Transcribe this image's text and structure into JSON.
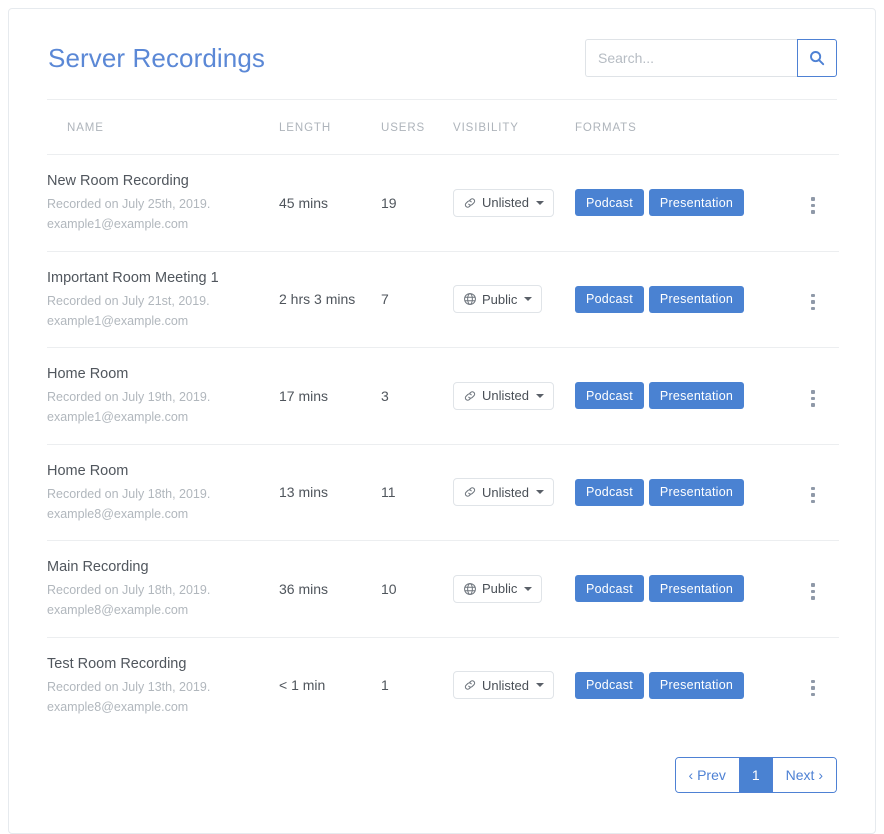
{
  "header": {
    "title": "Server Recordings",
    "search": {
      "placeholder": "Search...",
      "value": "",
      "button_icon": "search-icon"
    }
  },
  "table": {
    "columns": [
      {
        "key": "name",
        "label": "NAME"
      },
      {
        "key": "length",
        "label": "LENGTH"
      },
      {
        "key": "users",
        "label": "USERS"
      },
      {
        "key": "visibility",
        "label": "VISIBILITY"
      },
      {
        "key": "formats",
        "label": "FORMATS"
      },
      {
        "key": "actions",
        "label": ""
      }
    ],
    "rows": [
      {
        "name": "New Room Recording",
        "recorded_on": "Recorded on July 25th, 2019.",
        "email": "example1@example.com",
        "length": "45 mins",
        "users": "19",
        "visibility": "Unlisted",
        "visibility_icon": "link-icon",
        "formats": [
          "Podcast",
          "Presentation"
        ],
        "actions_icon": "kebab-menu-icon"
      },
      {
        "name": "Important Room Meeting 1",
        "recorded_on": "Recorded on July 21st, 2019.",
        "email": "example1@example.com",
        "length": "2 hrs 3 mins",
        "users": "7",
        "visibility": "Public",
        "visibility_icon": "globe-icon",
        "formats": [
          "Podcast",
          "Presentation"
        ],
        "actions_icon": "kebab-menu-icon"
      },
      {
        "name": "Home Room",
        "recorded_on": "Recorded on July 19th, 2019.",
        "email": "example1@example.com",
        "length": "17 mins",
        "users": "3",
        "visibility": "Unlisted",
        "visibility_icon": "link-icon",
        "formats": [
          "Podcast",
          "Presentation"
        ],
        "actions_icon": "kebab-menu-icon"
      },
      {
        "name": "Home Room",
        "recorded_on": "Recorded on July 18th, 2019.",
        "email": "example8@example.com",
        "length": "13 mins",
        "users": "11",
        "visibility": "Unlisted",
        "visibility_icon": "link-icon",
        "formats": [
          "Podcast",
          "Presentation"
        ],
        "actions_icon": "kebab-menu-icon"
      },
      {
        "name": "Main Recording",
        "recorded_on": "Recorded on July 18th, 2019.",
        "email": "example8@example.com",
        "length": "36 mins",
        "users": "10",
        "visibility": "Public",
        "visibility_icon": "globe-icon",
        "formats": [
          "Podcast",
          "Presentation"
        ],
        "actions_icon": "kebab-menu-icon"
      },
      {
        "name": "Test Room Recording",
        "recorded_on": "Recorded on July 13th, 2019.",
        "email": "example8@example.com",
        "length": "< 1 min",
        "users": "1",
        "visibility": "Unlisted",
        "visibility_icon": "link-icon",
        "formats": [
          "Podcast",
          "Presentation"
        ],
        "actions_icon": "kebab-menu-icon"
      }
    ]
  },
  "pagination": {
    "prev_label": "‹ Prev",
    "next_label": "Next ›",
    "pages": [
      "1"
    ],
    "current_page": "1"
  },
  "colors": {
    "accent_blue": "#4a82d2",
    "title_blue": "#5b88d6",
    "border_gray": "#e6eaee",
    "muted_text": "#b1b7bd",
    "header_text": "#aeb4bb"
  }
}
